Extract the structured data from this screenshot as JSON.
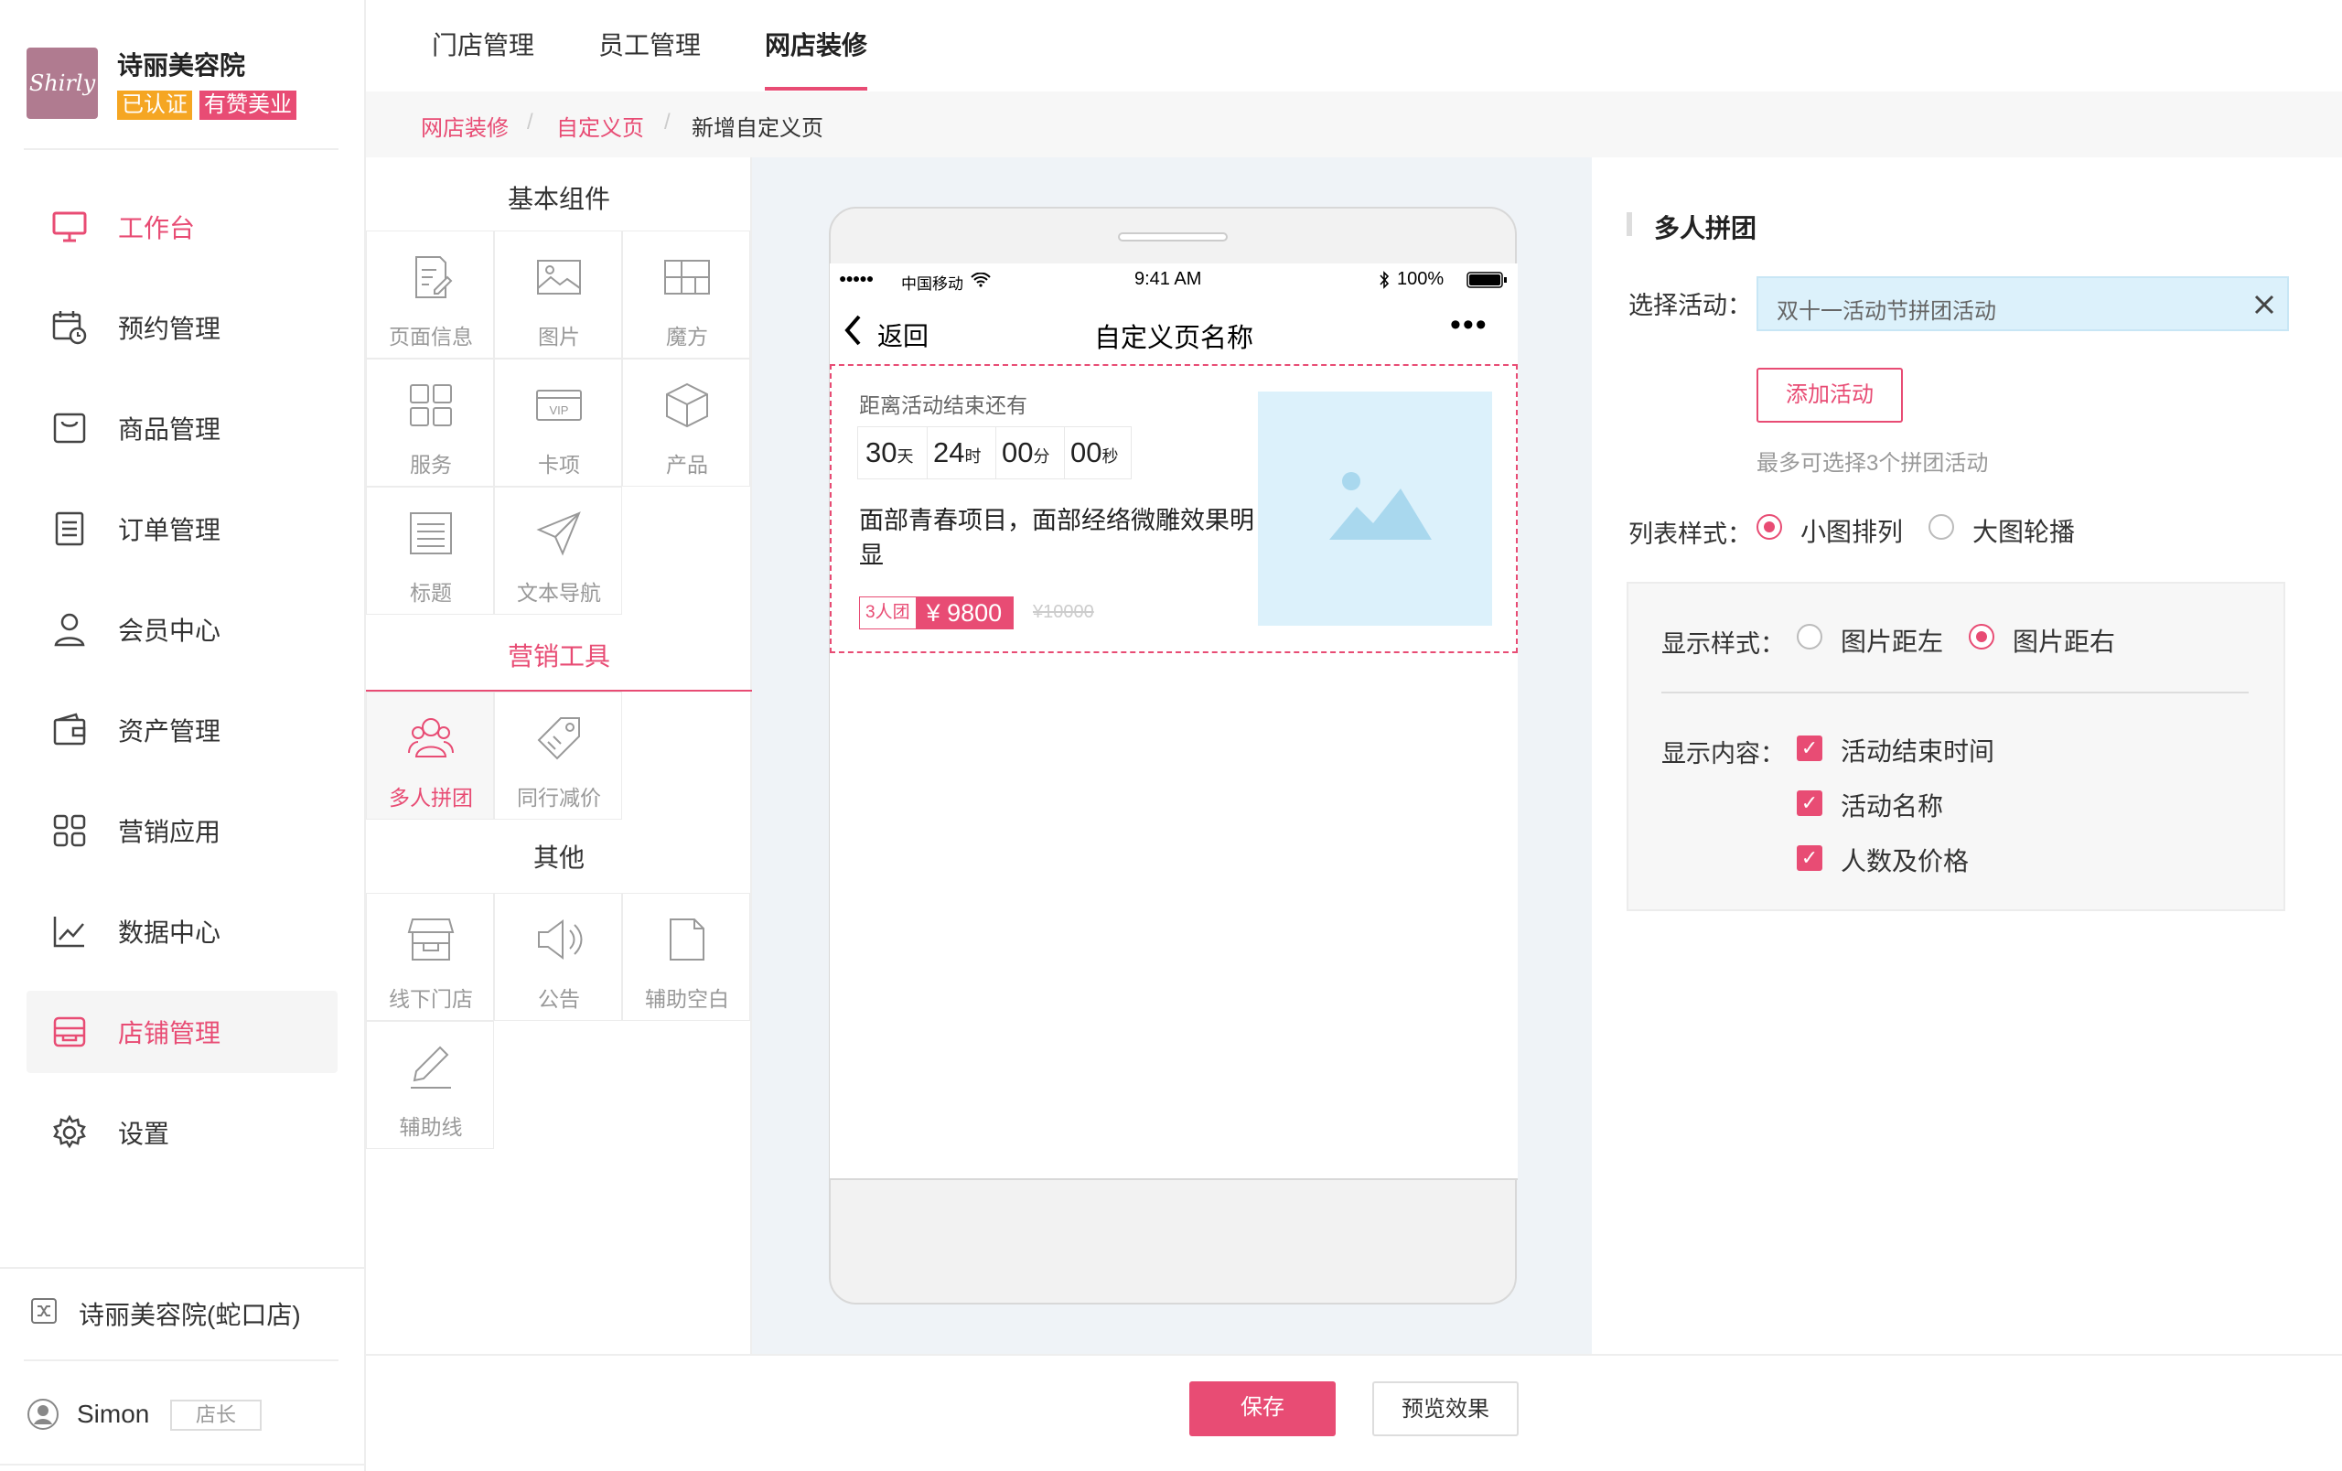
{
  "colors": {
    "accent": "#e84c74",
    "badge_verified": "#f5a623",
    "badge_youzan": "#e84c74",
    "canvas_bg": "#eff3f7",
    "image_placeholder": "#dcf1fb"
  },
  "store": {
    "logo_text": "Shirly",
    "name": "诗丽美容院",
    "badge_verified": "已认证",
    "badge_partner": "有赞美业"
  },
  "sidebar": {
    "items": [
      {
        "label": "工作台",
        "icon": "monitor-icon"
      },
      {
        "label": "预约管理",
        "icon": "calendar-clock-icon"
      },
      {
        "label": "商品管理",
        "icon": "bag-icon"
      },
      {
        "label": "订单管理",
        "icon": "order-list-icon"
      },
      {
        "label": "会员中心",
        "icon": "user-icon"
      },
      {
        "label": "资产管理",
        "icon": "wallet-icon"
      },
      {
        "label": "营销应用",
        "icon": "apps-grid-icon"
      },
      {
        "label": "数据中心",
        "icon": "chart-trend-icon"
      },
      {
        "label": "店铺管理",
        "icon": "store-icon"
      },
      {
        "label": "设置",
        "icon": "gear-icon"
      }
    ],
    "active_index": 8,
    "branch": "诗丽美容院(蛇口店)",
    "user": {
      "name": "Simon",
      "role": "店长"
    }
  },
  "topnav": {
    "tabs": [
      "门店管理",
      "员工管理",
      "网店装修"
    ],
    "active_index": 2
  },
  "breadcrumb": [
    "网店装修",
    "自定义页",
    "新增自定义页"
  ],
  "components": {
    "basic_title": "基本组件",
    "basic": [
      {
        "label": "页面信息",
        "icon": "page-edit-icon"
      },
      {
        "label": "图片",
        "icon": "image-icon"
      },
      {
        "label": "魔方",
        "icon": "cube-layout-icon"
      },
      {
        "label": "服务",
        "icon": "grid-four-icon"
      },
      {
        "label": "卡项",
        "icon": "vip-card-icon"
      },
      {
        "label": "产品",
        "icon": "box-icon"
      },
      {
        "label": "标题",
        "icon": "title-icon"
      },
      {
        "label": "文本导航",
        "icon": "navigation-icon"
      }
    ],
    "marketing_title": "营销工具",
    "marketing": [
      {
        "label": "多人拼团",
        "icon": "group-users-icon"
      },
      {
        "label": "同行减价",
        "icon": "price-tag-icon"
      }
    ],
    "other_title": "其他",
    "other": [
      {
        "label": "线下门店",
        "icon": "shop-icon"
      },
      {
        "label": "公告",
        "icon": "speaker-icon"
      },
      {
        "label": "辅助空白",
        "icon": "blank-page-icon"
      },
      {
        "label": "辅助线",
        "icon": "pencil-line-icon"
      }
    ]
  },
  "phone": {
    "carrier": "中国移动",
    "time": "9:41 AM",
    "battery": "100%",
    "back_label": "返回",
    "page_title": "自定义页名称",
    "more": "•••",
    "card": {
      "countdown_label": "距离活动结束还有",
      "countdown": [
        {
          "num": "30",
          "unit": "天"
        },
        {
          "num": "24",
          "unit": "时"
        },
        {
          "num": "00",
          "unit": "分"
        },
        {
          "num": "00",
          "unit": "秒"
        }
      ],
      "title": "面部青春项目，面部经络微雕效果明显",
      "group_tag": "3人团",
      "price": "¥ 9800",
      "orig_price": "¥10000"
    }
  },
  "settings": {
    "section_title": "多人拼团",
    "select_label": "选择活动：",
    "selected_activity": "双十一活动节拼团活动",
    "add_button": "添加活动",
    "hint": "最多可选择3个拼团活动",
    "list_style_label": "列表样式：",
    "list_styles": [
      {
        "label": "小图排列",
        "selected": true
      },
      {
        "label": "大图轮播",
        "selected": false
      }
    ],
    "display_style_label": "显示样式：",
    "display_styles": [
      {
        "label": "图片距左",
        "selected": false
      },
      {
        "label": "图片距右",
        "selected": true
      }
    ],
    "display_content_label": "显示内容：",
    "display_contents": [
      {
        "label": "活动结束时间",
        "checked": true
      },
      {
        "label": "活动名称",
        "checked": true
      },
      {
        "label": "人数及价格",
        "checked": true
      }
    ]
  },
  "footer": {
    "save": "保存",
    "preview": "预览效果"
  }
}
